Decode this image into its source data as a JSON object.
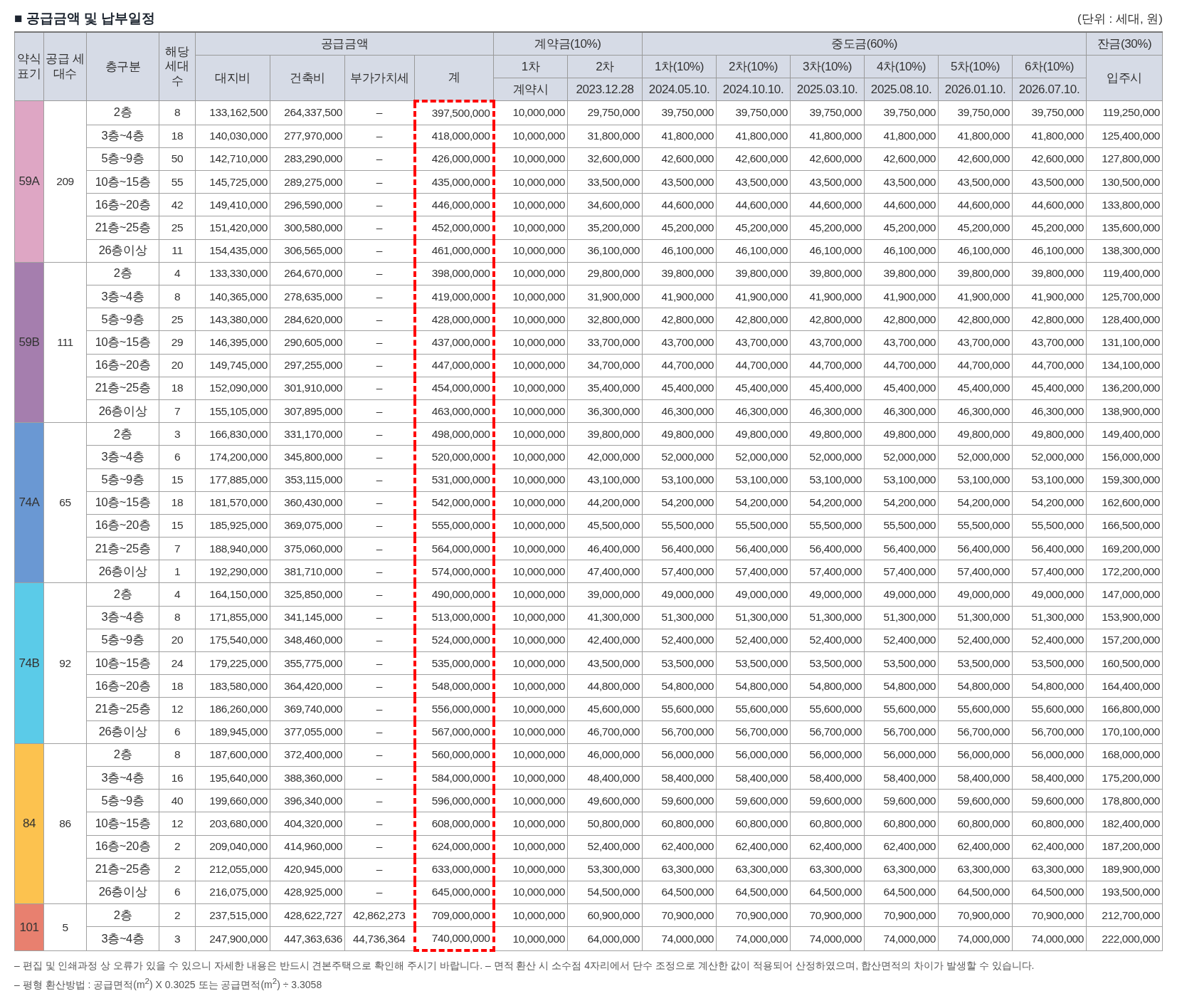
{
  "title": "■ 공급금액 및 납부일정",
  "unit": "(단위 : 세대, 원)",
  "table": {
    "header": {
      "type_label": "약식 표기",
      "households_label": "공급 세대수",
      "floor_label": "층구분",
      "units_label": "해당 세대 수",
      "supply": {
        "label": "공급금액",
        "columns": [
          "대지비",
          "건축비",
          "부가가치세",
          "계"
        ]
      },
      "deposit": {
        "label": "계약금(10%)",
        "columns": [
          {
            "label": "1차",
            "date": "계약시"
          },
          {
            "label": "2차",
            "date": "2023.12.28"
          }
        ]
      },
      "middle": {
        "label": "중도금(60%)",
        "columns": [
          {
            "label": "1차(10%)",
            "date": "2024.05.10."
          },
          {
            "label": "2차(10%)",
            "date": "2024.10.10."
          },
          {
            "label": "3차(10%)",
            "date": "2025.03.10."
          },
          {
            "label": "4차(10%)",
            "date": "2025.08.10."
          },
          {
            "label": "5차(10%)",
            "date": "2026.01.10."
          },
          {
            "label": "6차(10%)",
            "date": "2026.07.10."
          }
        ]
      },
      "balance": {
        "label": "잔금(30%)",
        "date": "입주시"
      }
    },
    "groups": [
      {
        "type": "59A",
        "color": "#dea6c4",
        "households": "209",
        "rows": [
          [
            "2층",
            "8",
            "133,162,500",
            "264,337,500",
            "–",
            "397,500,000",
            "10,000,000",
            "29,750,000",
            "39,750,000",
            "39,750,000",
            "39,750,000",
            "39,750,000",
            "39,750,000",
            "39,750,000",
            "119,250,000"
          ],
          [
            "3층~4층",
            "18",
            "140,030,000",
            "277,970,000",
            "–",
            "418,000,000",
            "10,000,000",
            "31,800,000",
            "41,800,000",
            "41,800,000",
            "41,800,000",
            "41,800,000",
            "41,800,000",
            "41,800,000",
            "125,400,000"
          ],
          [
            "5층~9층",
            "50",
            "142,710,000",
            "283,290,000",
            "–",
            "426,000,000",
            "10,000,000",
            "32,600,000",
            "42,600,000",
            "42,600,000",
            "42,600,000",
            "42,600,000",
            "42,600,000",
            "42,600,000",
            "127,800,000"
          ],
          [
            "10층~15층",
            "55",
            "145,725,000",
            "289,275,000",
            "–",
            "435,000,000",
            "10,000,000",
            "33,500,000",
            "43,500,000",
            "43,500,000",
            "43,500,000",
            "43,500,000",
            "43,500,000",
            "43,500,000",
            "130,500,000"
          ],
          [
            "16층~20층",
            "42",
            "149,410,000",
            "296,590,000",
            "–",
            "446,000,000",
            "10,000,000",
            "34,600,000",
            "44,600,000",
            "44,600,000",
            "44,600,000",
            "44,600,000",
            "44,600,000",
            "44,600,000",
            "133,800,000"
          ],
          [
            "21층~25층",
            "25",
            "151,420,000",
            "300,580,000",
            "–",
            "452,000,000",
            "10,000,000",
            "35,200,000",
            "45,200,000",
            "45,200,000",
            "45,200,000",
            "45,200,000",
            "45,200,000",
            "45,200,000",
            "135,600,000"
          ],
          [
            "26층이상",
            "11",
            "154,435,000",
            "306,565,000",
            "–",
            "461,000,000",
            "10,000,000",
            "36,100,000",
            "46,100,000",
            "46,100,000",
            "46,100,000",
            "46,100,000",
            "46,100,000",
            "46,100,000",
            "138,300,000"
          ]
        ]
      },
      {
        "type": "59B",
        "color": "#a57eae",
        "households": "111",
        "rows": [
          [
            "2층",
            "4",
            "133,330,000",
            "264,670,000",
            "–",
            "398,000,000",
            "10,000,000",
            "29,800,000",
            "39,800,000",
            "39,800,000",
            "39,800,000",
            "39,800,000",
            "39,800,000",
            "39,800,000",
            "119,400,000"
          ],
          [
            "3층~4층",
            "8",
            "140,365,000",
            "278,635,000",
            "–",
            "419,000,000",
            "10,000,000",
            "31,900,000",
            "41,900,000",
            "41,900,000",
            "41,900,000",
            "41,900,000",
            "41,900,000",
            "41,900,000",
            "125,700,000"
          ],
          [
            "5층~9층",
            "25",
            "143,380,000",
            "284,620,000",
            "–",
            "428,000,000",
            "10,000,000",
            "32,800,000",
            "42,800,000",
            "42,800,000",
            "42,800,000",
            "42,800,000",
            "42,800,000",
            "42,800,000",
            "128,400,000"
          ],
          [
            "10층~15층",
            "29",
            "146,395,000",
            "290,605,000",
            "–",
            "437,000,000",
            "10,000,000",
            "33,700,000",
            "43,700,000",
            "43,700,000",
            "43,700,000",
            "43,700,000",
            "43,700,000",
            "43,700,000",
            "131,100,000"
          ],
          [
            "16층~20층",
            "20",
            "149,745,000",
            "297,255,000",
            "–",
            "447,000,000",
            "10,000,000",
            "34,700,000",
            "44,700,000",
            "44,700,000",
            "44,700,000",
            "44,700,000",
            "44,700,000",
            "44,700,000",
            "134,100,000"
          ],
          [
            "21층~25층",
            "18",
            "152,090,000",
            "301,910,000",
            "–",
            "454,000,000",
            "10,000,000",
            "35,400,000",
            "45,400,000",
            "45,400,000",
            "45,400,000",
            "45,400,000",
            "45,400,000",
            "45,400,000",
            "136,200,000"
          ],
          [
            "26층이상",
            "7",
            "155,105,000",
            "307,895,000",
            "–",
            "463,000,000",
            "10,000,000",
            "36,300,000",
            "46,300,000",
            "46,300,000",
            "46,300,000",
            "46,300,000",
            "46,300,000",
            "46,300,000",
            "138,900,000"
          ]
        ]
      },
      {
        "type": "74A",
        "color": "#6a98d3",
        "households": "65",
        "rows": [
          [
            "2층",
            "3",
            "166,830,000",
            "331,170,000",
            "–",
            "498,000,000",
            "10,000,000",
            "39,800,000",
            "49,800,000",
            "49,800,000",
            "49,800,000",
            "49,800,000",
            "49,800,000",
            "49,800,000",
            "149,400,000"
          ],
          [
            "3층~4층",
            "6",
            "174,200,000",
            "345,800,000",
            "–",
            "520,000,000",
            "10,000,000",
            "42,000,000",
            "52,000,000",
            "52,000,000",
            "52,000,000",
            "52,000,000",
            "52,000,000",
            "52,000,000",
            "156,000,000"
          ],
          [
            "5층~9층",
            "15",
            "177,885,000",
            "353,115,000",
            "–",
            "531,000,000",
            "10,000,000",
            "43,100,000",
            "53,100,000",
            "53,100,000",
            "53,100,000",
            "53,100,000",
            "53,100,000",
            "53,100,000",
            "159,300,000"
          ],
          [
            "10층~15층",
            "18",
            "181,570,000",
            "360,430,000",
            "–",
            "542,000,000",
            "10,000,000",
            "44,200,000",
            "54,200,000",
            "54,200,000",
            "54,200,000",
            "54,200,000",
            "54,200,000",
            "54,200,000",
            "162,600,000"
          ],
          [
            "16층~20층",
            "15",
            "185,925,000",
            "369,075,000",
            "–",
            "555,000,000",
            "10,000,000",
            "45,500,000",
            "55,500,000",
            "55,500,000",
            "55,500,000",
            "55,500,000",
            "55,500,000",
            "55,500,000",
            "166,500,000"
          ],
          [
            "21층~25층",
            "7",
            "188,940,000",
            "375,060,000",
            "–",
            "564,000,000",
            "10,000,000",
            "46,400,000",
            "56,400,000",
            "56,400,000",
            "56,400,000",
            "56,400,000",
            "56,400,000",
            "56,400,000",
            "169,200,000"
          ],
          [
            "26층이상",
            "1",
            "192,290,000",
            "381,710,000",
            "–",
            "574,000,000",
            "10,000,000",
            "47,400,000",
            "57,400,000",
            "57,400,000",
            "57,400,000",
            "57,400,000",
            "57,400,000",
            "57,400,000",
            "172,200,000"
          ]
        ]
      },
      {
        "type": "74B",
        "color": "#5bcbe8",
        "households": "92",
        "rows": [
          [
            "2층",
            "4",
            "164,150,000",
            "325,850,000",
            "–",
            "490,000,000",
            "10,000,000",
            "39,000,000",
            "49,000,000",
            "49,000,000",
            "49,000,000",
            "49,000,000",
            "49,000,000",
            "49,000,000",
            "147,000,000"
          ],
          [
            "3층~4층",
            "8",
            "171,855,000",
            "341,145,000",
            "–",
            "513,000,000",
            "10,000,000",
            "41,300,000",
            "51,300,000",
            "51,300,000",
            "51,300,000",
            "51,300,000",
            "51,300,000",
            "51,300,000",
            "153,900,000"
          ],
          [
            "5층~9층",
            "20",
            "175,540,000",
            "348,460,000",
            "–",
            "524,000,000",
            "10,000,000",
            "42,400,000",
            "52,400,000",
            "52,400,000",
            "52,400,000",
            "52,400,000",
            "52,400,000",
            "52,400,000",
            "157,200,000"
          ],
          [
            "10층~15층",
            "24",
            "179,225,000",
            "355,775,000",
            "–",
            "535,000,000",
            "10,000,000",
            "43,500,000",
            "53,500,000",
            "53,500,000",
            "53,500,000",
            "53,500,000",
            "53,500,000",
            "53,500,000",
            "160,500,000"
          ],
          [
            "16층~20층",
            "18",
            "183,580,000",
            "364,420,000",
            "–",
            "548,000,000",
            "10,000,000",
            "44,800,000",
            "54,800,000",
            "54,800,000",
            "54,800,000",
            "54,800,000",
            "54,800,000",
            "54,800,000",
            "164,400,000"
          ],
          [
            "21층~25층",
            "12",
            "186,260,000",
            "369,740,000",
            "–",
            "556,000,000",
            "10,000,000",
            "45,600,000",
            "55,600,000",
            "55,600,000",
            "55,600,000",
            "55,600,000",
            "55,600,000",
            "55,600,000",
            "166,800,000"
          ],
          [
            "26층이상",
            "6",
            "189,945,000",
            "377,055,000",
            "–",
            "567,000,000",
            "10,000,000",
            "46,700,000",
            "56,700,000",
            "56,700,000",
            "56,700,000",
            "56,700,000",
            "56,700,000",
            "56,700,000",
            "170,100,000"
          ]
        ]
      },
      {
        "type": "84",
        "color": "#fcc24f",
        "households": "86",
        "rows": [
          [
            "2층",
            "8",
            "187,600,000",
            "372,400,000",
            "–",
            "560,000,000",
            "10,000,000",
            "46,000,000",
            "56,000,000",
            "56,000,000",
            "56,000,000",
            "56,000,000",
            "56,000,000",
            "56,000,000",
            "168,000,000"
          ],
          [
            "3층~4층",
            "16",
            "195,640,000",
            "388,360,000",
            "–",
            "584,000,000",
            "10,000,000",
            "48,400,000",
            "58,400,000",
            "58,400,000",
            "58,400,000",
            "58,400,000",
            "58,400,000",
            "58,400,000",
            "175,200,000"
          ],
          [
            "5층~9층",
            "40",
            "199,660,000",
            "396,340,000",
            "–",
            "596,000,000",
            "10,000,000",
            "49,600,000",
            "59,600,000",
            "59,600,000",
            "59,600,000",
            "59,600,000",
            "59,600,000",
            "59,600,000",
            "178,800,000"
          ],
          [
            "10층~15층",
            "12",
            "203,680,000",
            "404,320,000",
            "–",
            "608,000,000",
            "10,000,000",
            "50,800,000",
            "60,800,000",
            "60,800,000",
            "60,800,000",
            "60,800,000",
            "60,800,000",
            "60,800,000",
            "182,400,000"
          ],
          [
            "16층~20층",
            "2",
            "209,040,000",
            "414,960,000",
            "–",
            "624,000,000",
            "10,000,000",
            "52,400,000",
            "62,400,000",
            "62,400,000",
            "62,400,000",
            "62,400,000",
            "62,400,000",
            "62,400,000",
            "187,200,000"
          ],
          [
            "21층~25층",
            "2",
            "212,055,000",
            "420,945,000",
            "–",
            "633,000,000",
            "10,000,000",
            "53,300,000",
            "63,300,000",
            "63,300,000",
            "63,300,000",
            "63,300,000",
            "63,300,000",
            "63,300,000",
            "189,900,000"
          ],
          [
            "26층이상",
            "6",
            "216,075,000",
            "428,925,000",
            "–",
            "645,000,000",
            "10,000,000",
            "54,500,000",
            "64,500,000",
            "64,500,000",
            "64,500,000",
            "64,500,000",
            "64,500,000",
            "64,500,000",
            "193,500,000"
          ]
        ]
      },
      {
        "type": "101",
        "color": "#e8806f",
        "households": "5",
        "rows": [
          [
            "2층",
            "2",
            "237,515,000",
            "428,622,727",
            "42,862,273",
            "709,000,000",
            "10,000,000",
            "60,900,000",
            "70,900,000",
            "70,900,000",
            "70,900,000",
            "70,900,000",
            "70,900,000",
            "70,900,000",
            "212,700,000"
          ],
          [
            "3층~4층",
            "3",
            "247,900,000",
            "447,363,636",
            "44,736,364",
            "740,000,000",
            "10,000,000",
            "64,000,000",
            "74,000,000",
            "74,000,000",
            "74,000,000",
            "74,000,000",
            "74,000,000",
            "74,000,000",
            "222,000,000"
          ]
        ]
      }
    ]
  },
  "notes": [
    "– 편집 및 인쇄과정 상 오류가 있을 수 있으니 자세한 내용은 반드시 견본주택으로 확인해 주시기 바랍니다. – 면적 환산 시 소수점 4자리에서 단수 조정으로 계산한 값이 적용되어 산정하였으며, 합산면적의 차이가 발생할 수 있습니다.",
    "– 평형 환산방법 : 공급면적(m$^{2}$) X 0.3025 또는 공급면적(m$^{2}$) ÷ 3.3058"
  ]
}
